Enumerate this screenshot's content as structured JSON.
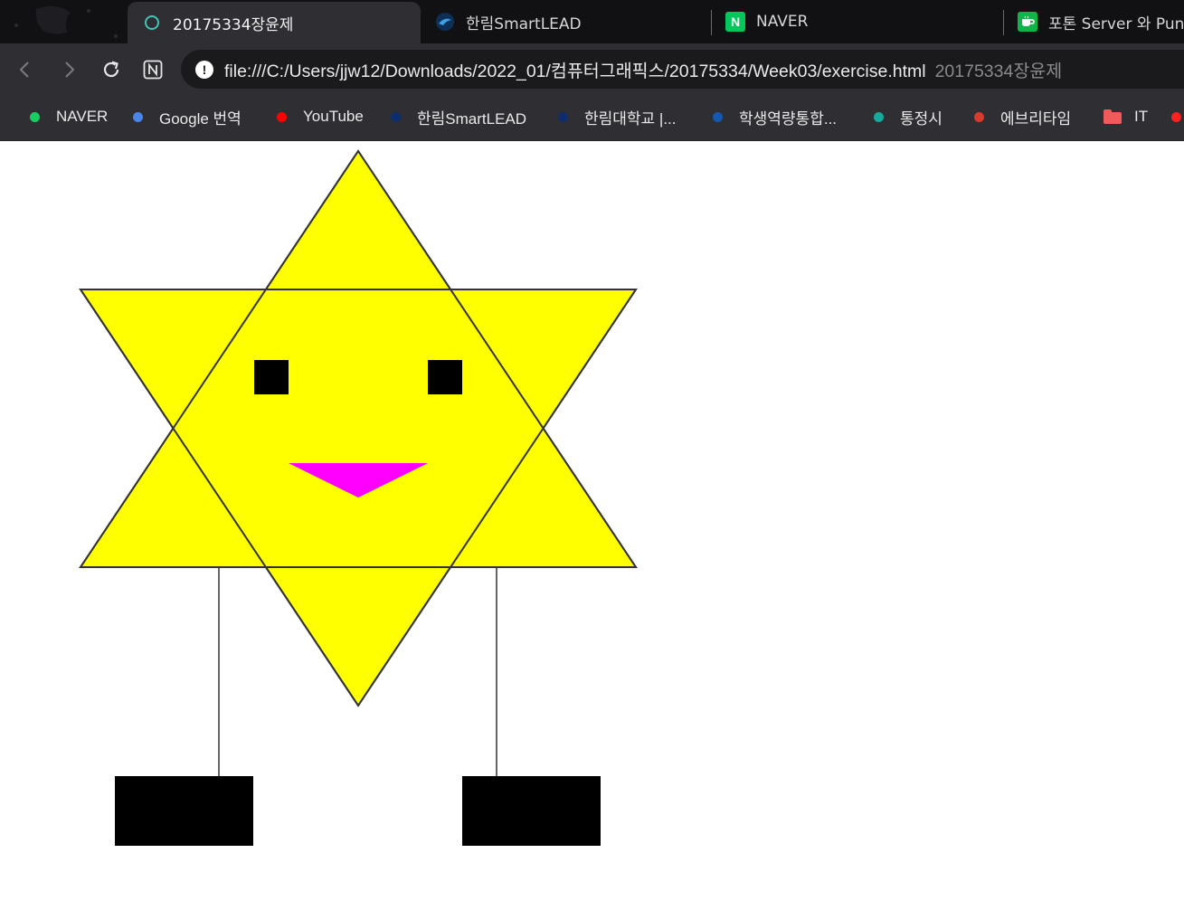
{
  "tabs": [
    {
      "title": "20175334장윤제",
      "icon": "loading-ring-icon",
      "active": true
    },
    {
      "title": "한림SmartLEAD",
      "icon": "smartlead-icon",
      "active": false
    },
    {
      "title": "NAVER",
      "icon": "naver-n-icon",
      "active": false
    },
    {
      "title": "포톤 Server 와 Pun",
      "icon": "cafe-cup-icon",
      "active": false
    }
  ],
  "toolbar": {
    "back_icon": "back-arrow-icon",
    "forward_icon": "forward-arrow-icon",
    "reload_icon": "reload-icon",
    "notion_icon": "notion-icon"
  },
  "address": {
    "security_icon": "info-icon",
    "url": "file:///C:/Users/jjw12/Downloads/2022_01/컴퓨터그래픽스/20175334/Week03/exercise.html",
    "page_title": "20175334장윤제"
  },
  "bookmarks": [
    {
      "label": "NAVER",
      "color": "#19ce60"
    },
    {
      "label": "Google 번역",
      "color": "#4a86e8"
    },
    {
      "label": "YouTube",
      "color": "#ff0000"
    },
    {
      "label": "한림SmartLEAD",
      "color": "#0d2e6e"
    },
    {
      "label": "한림대학교 |...",
      "color": "#0d2e6e"
    },
    {
      "label": "학생역량통합...",
      "color": "#1558b0"
    },
    {
      "label": "통정시",
      "color": "#17a99b"
    },
    {
      "label": "에브리타임",
      "color": "#d93a2b"
    },
    {
      "label": "IT",
      "color": "#f05a5a",
      "folder": true
    },
    {
      "label": "",
      "color": "#ff2020"
    }
  ],
  "drawing": {
    "star_fill": "#ffff00",
    "mouth_fill": "#ff00ff",
    "feature_fill": "#000000",
    "outline": "#333333"
  }
}
